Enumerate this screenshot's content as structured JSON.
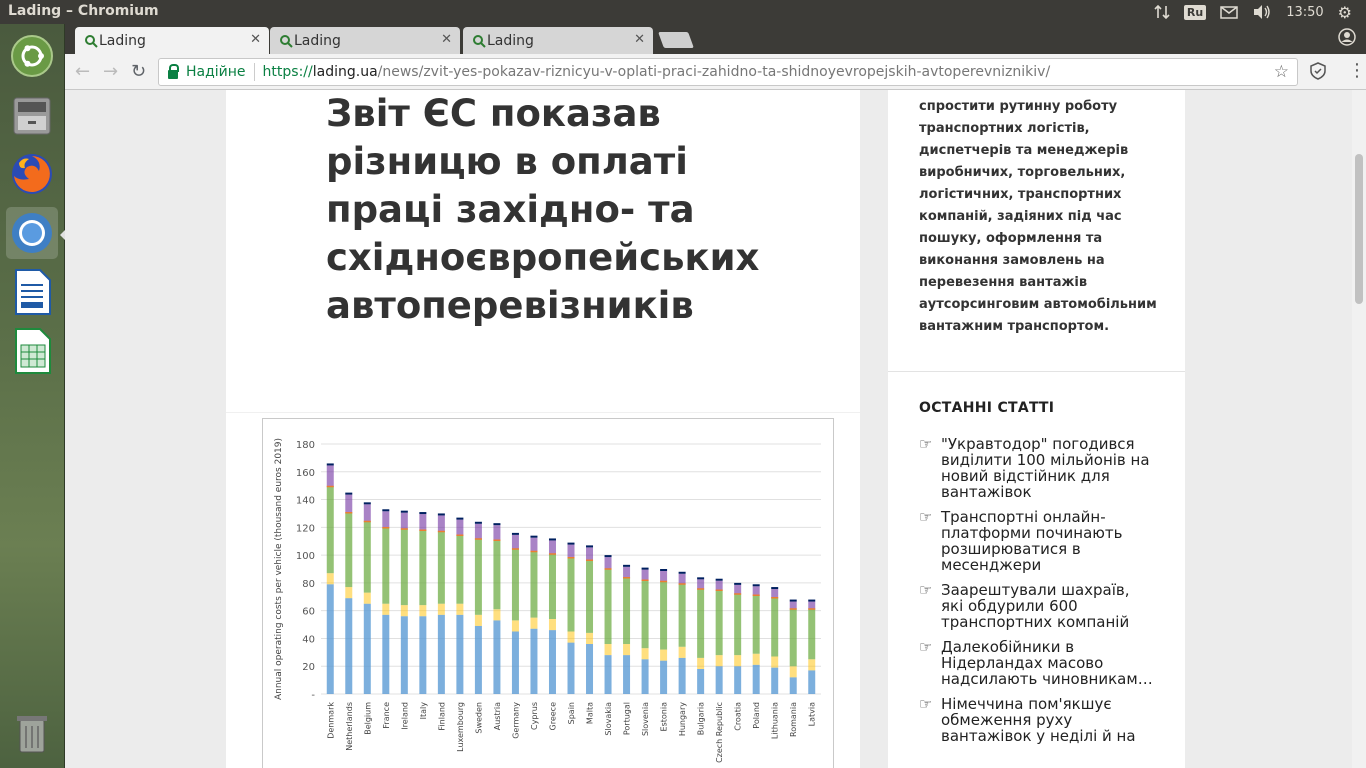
{
  "window": {
    "title": "Lading – Chromium"
  },
  "tray": {
    "keyboard": "Ru",
    "clock": "13:50"
  },
  "tabs": [
    {
      "label": "Lading",
      "active": true
    },
    {
      "label": "Lading",
      "active": false
    },
    {
      "label": "Lading",
      "active": false
    }
  ],
  "omnibox": {
    "secure_label": "Надійне",
    "url_scheme": "https://",
    "url_host": "lading.ua",
    "url_path": "/news/zvit-yes-pokazav-riznicyu-v-oplati-praci-zahidno-ta-shidnoyevropejskih-avtoperevniznikiv/"
  },
  "article": {
    "headline": "Звіт ЄС показав\nрізницю в оплаті\nпраці західно- та\nсхідноєвропейських\nавтоперевізників"
  },
  "sidebar": {
    "description": "спростити рутинну роботу\nтранспортних логістів,\nдиспетчерів та менеджерів\nвиробничих, торговельних,\nлогістичних, транспортних\nкомпаній, задіяних під час\nпошуку, оформлення та\nвиконання замовлень на\nперевезення вантажів\nаутсорсинговим автомобільним\nвантажним транспортом.",
    "latest_heading": "ОСТАННІ СТАТТІ",
    "latest": [
      "\"Укравтодор\" погодився\nвиділити 100 мільйонів на\nновий відстійник для\nвантажівок",
      "Транспортні онлайн-\nплатформи починають\nрозширюватися в\nмесенджери",
      "Заарештували шахраїв,\nякі обдурили 600\nтранспортних компаній",
      "Далекобійники в Нідерландах масово надсилають чиновникам туалетний папір",
      "Німеччина пом'якшує\nобмеження руху\nвантажівок у неділі й на"
    ]
  },
  "chart_data": {
    "type": "bar",
    "ylabel": "Annual operating costs per vehicle (thousand euros 2019)",
    "ylim": [
      0,
      180
    ],
    "yticks": [
      "-",
      "20",
      "40",
      "60",
      "80",
      "100",
      "120",
      "140",
      "160",
      "180"
    ],
    "categories": [
      "Denmark",
      "Netherlands",
      "Belgium",
      "France",
      "Ireland",
      "Italy",
      "Finland",
      "Luxembourg",
      "Sweden",
      "Austria",
      "Germany",
      "Cyprus",
      "Greece",
      "Spain",
      "Malta",
      "Slovakia",
      "Portugal",
      "Slovenia",
      "Estonia",
      "Hungary",
      "Bulgaria",
      "Czech Republic",
      "Croatia",
      "Poland",
      "Lithuania",
      "Romania",
      "Latvia"
    ],
    "values": [
      166,
      145,
      138,
      133,
      132,
      131,
      130,
      127,
      124,
      123,
      116,
      114,
      112,
      109,
      107,
      100,
      93,
      91,
      90,
      88,
      84,
      83,
      80,
      79,
      77,
      68,
      68
    ],
    "labour_share": [
      79,
      69,
      65,
      57,
      56,
      56,
      57,
      57,
      49,
      53,
      45,
      47,
      46,
      37,
      36,
      28,
      28,
      25,
      24,
      26,
      18,
      20,
      20,
      21,
      19,
      12,
      17
    ],
    "colors": {
      "labour": "#5b9bd5",
      "fuel": "#70ad47",
      "other1": "#ffc000",
      "other2": "#7030a0",
      "other3": "#ed7d31",
      "top": "#002060"
    }
  }
}
